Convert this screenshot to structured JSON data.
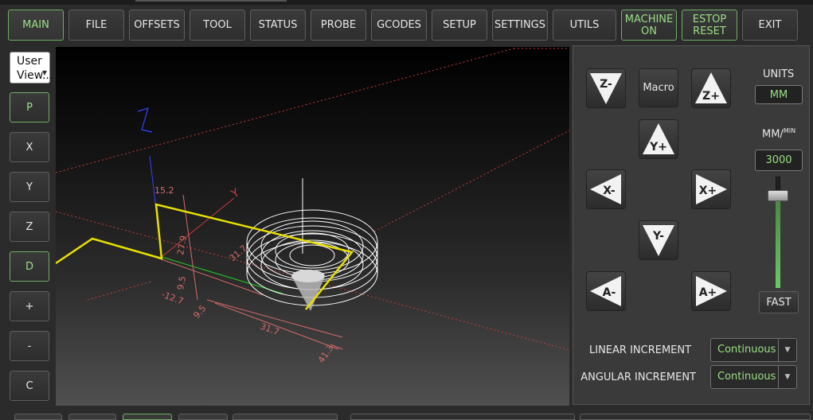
{
  "toolbar": {
    "buttons": [
      {
        "label": "MAIN",
        "state": "active"
      },
      {
        "label": "FILE"
      },
      {
        "label": "OFFSETS"
      },
      {
        "label": "TOOL"
      },
      {
        "label": "STATUS"
      },
      {
        "label": "PROBE"
      },
      {
        "label": "GCODES"
      },
      {
        "label": "SETUP"
      },
      {
        "label": "SETTINGS"
      },
      {
        "label": "UTILS"
      }
    ],
    "machine_on": {
      "line1": "MACHINE",
      "line2": "ON"
    },
    "estop_reset": {
      "line1": "ESTOP",
      "line2": "RESET"
    },
    "exit": "EXIT"
  },
  "view_selector": {
    "line1": "User",
    "line2": "View..."
  },
  "view_buttons": [
    "P",
    "X",
    "Y",
    "Z",
    "D",
    "+",
    "-",
    "C"
  ],
  "viewport": {
    "axis_labels": {
      "z": "Z",
      "y": "Y"
    },
    "dimensions": [
      "15.2",
      "27.9",
      "31.7",
      "9.5",
      "-12.7",
      "9.5",
      "31.7",
      "41.3"
    ]
  },
  "jog": {
    "z_minus": "Z-",
    "z_plus": "Z+",
    "y_plus": "Y+",
    "y_minus": "Y-",
    "x_minus": "X-",
    "x_plus": "X+",
    "a_minus": "A-",
    "a_plus": "A+",
    "macro": "Macro"
  },
  "units": {
    "label": "UNITS",
    "value": "MM"
  },
  "feed": {
    "label_main": "MM/",
    "label_sup": "MIN",
    "value": "3000",
    "level": 0.83,
    "fast_label": "FAST"
  },
  "linear_increment": {
    "label": "LINEAR INCREMENT",
    "value": "Continuous"
  },
  "angular_increment": {
    "label": "ANGULAR INCREMENT",
    "value": "Continuous"
  },
  "colors": {
    "accent_green": "#9adf84",
    "path_yellow": "#e8e000",
    "grid_red": "#c83c3c"
  }
}
